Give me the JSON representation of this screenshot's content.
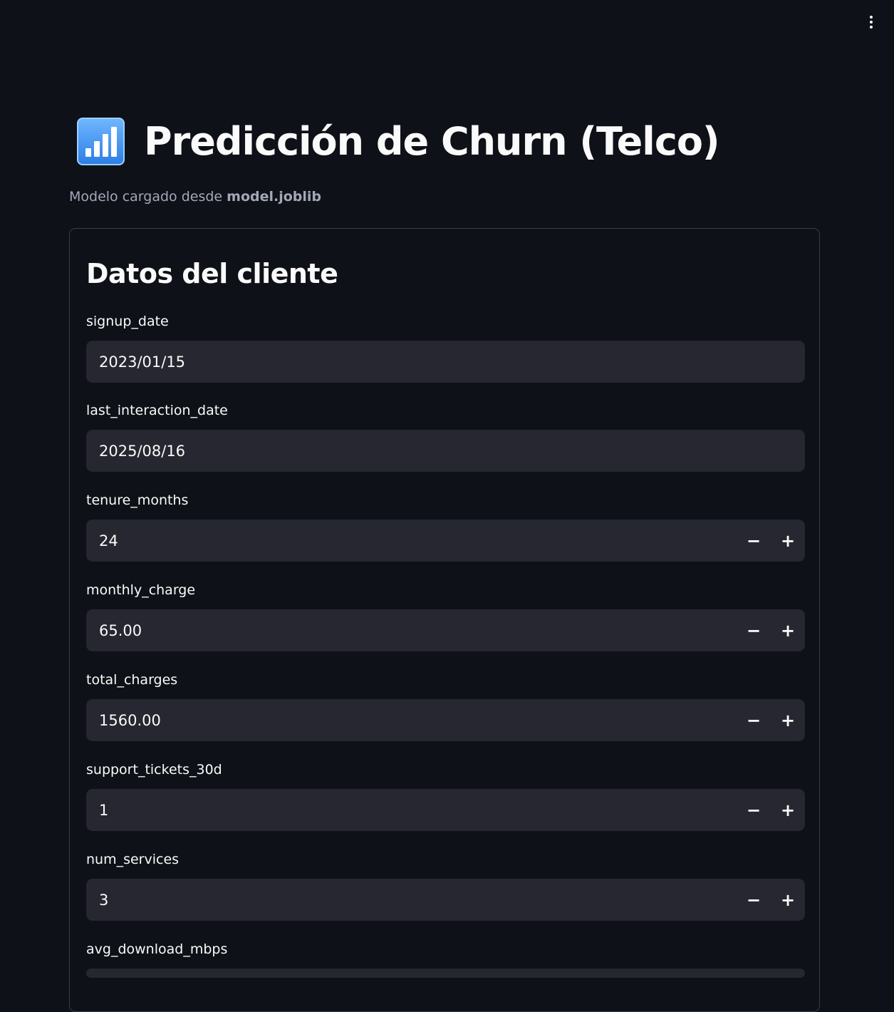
{
  "header": {
    "menu_icon": "vertical-dots-icon"
  },
  "title": {
    "icon": "bar-chart-icon",
    "text": "Predicción de Churn (Telco)"
  },
  "caption": {
    "prefix": "Modelo cargado desde ",
    "model_file": "model.joblib"
  },
  "form": {
    "title": "Datos del cliente",
    "fields": [
      {
        "label": "signup_date",
        "value": "2023/01/15",
        "type": "date"
      },
      {
        "label": "last_interaction_date",
        "value": "2025/08/16",
        "type": "date"
      },
      {
        "label": "tenure_months",
        "value": "24",
        "type": "number"
      },
      {
        "label": "monthly_charge",
        "value": "65.00",
        "type": "number"
      },
      {
        "label": "total_charges",
        "value": "1560.00",
        "type": "number"
      },
      {
        "label": "support_tickets_30d",
        "value": "1",
        "type": "number"
      },
      {
        "label": "num_services",
        "value": "3",
        "type": "number"
      },
      {
        "label": "avg_download_mbps",
        "value": "",
        "type": "number"
      }
    ],
    "stepper": {
      "decrement": "−",
      "increment": "+"
    }
  },
  "colors": {
    "background": "#0e1117",
    "input_background": "#262730",
    "text": "#fafafa",
    "caption": "#a3a8b8",
    "border": "#3a3d46"
  }
}
